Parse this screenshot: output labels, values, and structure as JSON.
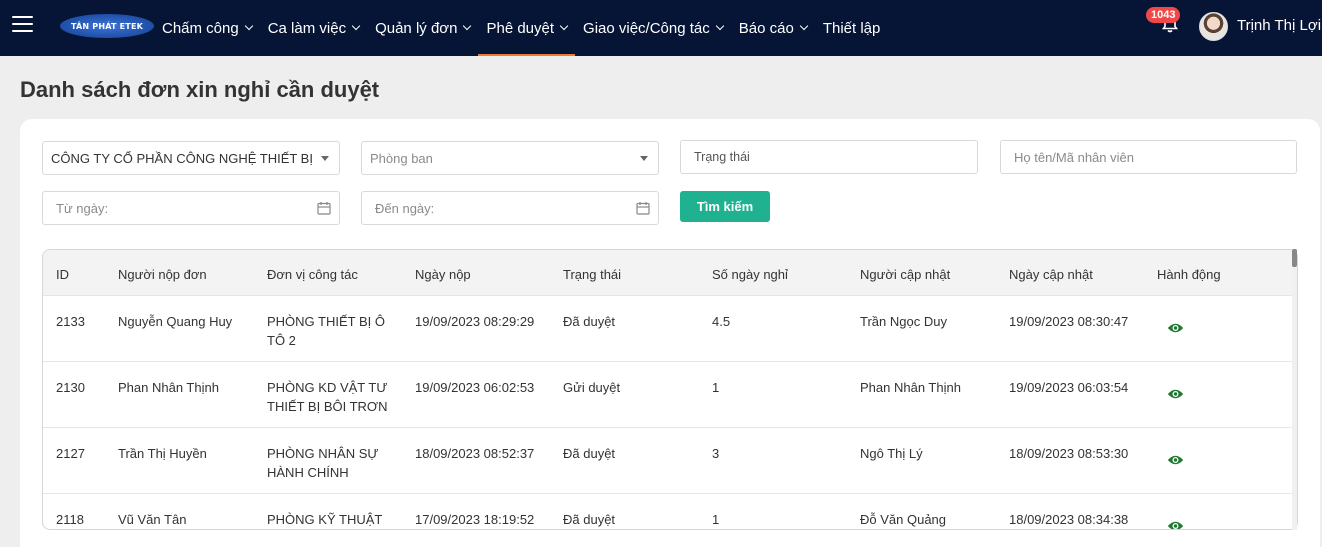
{
  "nav": {
    "logo_text": "TÂN PHÁT ETEK",
    "menu": [
      {
        "label": "Chấm công",
        "has_dropdown": true,
        "active": false
      },
      {
        "label": "Ca làm việc",
        "has_dropdown": true,
        "active": false
      },
      {
        "label": "Quản lý đơn",
        "has_dropdown": true,
        "active": false
      },
      {
        "label": "Phê duyệt",
        "has_dropdown": true,
        "active": true
      },
      {
        "label": "Giao việc/Công tác",
        "has_dropdown": true,
        "active": false
      },
      {
        "label": "Báo cáo",
        "has_dropdown": true,
        "active": false
      },
      {
        "label": "Thiết lập",
        "has_dropdown": false,
        "active": false
      }
    ],
    "notification_count": "1043",
    "user_name": "Trịnh Thị Lợi"
  },
  "page": {
    "title": "Danh sách đơn xin nghỉ cần duyệt"
  },
  "filters": {
    "company_value": "CÔNG TY CỔ PHẦN CÔNG NGHỆ THIẾT BỊ TÂ...",
    "department_placeholder": "Phòng ban",
    "status_placeholder": "Trạng thái",
    "employee_placeholder": "Họ tên/Mã nhân viên",
    "from_date_placeholder": "Từ ngày:",
    "to_date_placeholder": "Đến ngày:",
    "search_label": "Tìm kiếm"
  },
  "table": {
    "columns": [
      "ID",
      "Người nộp đơn",
      "Đơn vị công tác",
      "Ngày nộp",
      "Trạng thái",
      "Số ngày nghỉ",
      "Người cập nhật",
      "Ngày cập nhật",
      "Hành động"
    ],
    "rows": [
      {
        "id": "2133",
        "applicant": "Nguyễn Quang Huy",
        "unit": "PHÒNG THIẾT BỊ Ô TÔ 2",
        "submitted": "19/09/2023 08:29:29",
        "status": "Đã duyệt",
        "days": "4.5",
        "updated_by": "Trần Ngọc Duy",
        "updated_at": "19/09/2023 08:30:47"
      },
      {
        "id": "2130",
        "applicant": "Phan Nhân Thịnh",
        "unit": "PHÒNG KD VẬT TƯ THIẾT BỊ BÔI TRƠN",
        "submitted": "19/09/2023 06:02:53",
        "status": "Gửi duyệt",
        "days": "1",
        "updated_by": "Phan Nhân Thịnh",
        "updated_at": "19/09/2023 06:03:54"
      },
      {
        "id": "2127",
        "applicant": "Trần Thị Huyền",
        "unit": "PHÒNG NHÂN SỰ HÀNH CHÍNH",
        "submitted": "18/09/2023 08:52:37",
        "status": "Đã duyệt",
        "days": "3",
        "updated_by": "Ngô Thị Lý",
        "updated_at": "18/09/2023 08:53:30"
      },
      {
        "id": "2118",
        "applicant": "Vũ Văn Tân",
        "unit": "PHÒNG KỸ THUẬT",
        "submitted": "17/09/2023 18:19:52",
        "status": "Đã duyệt",
        "days": "1",
        "updated_by": "Đỗ Văn Quảng",
        "updated_at": "18/09/2023 08:34:38"
      }
    ]
  },
  "colors": {
    "nav_bg": "#061536",
    "accent": "#f07a34",
    "button": "#20b290",
    "eye_icon": "#1f7a2e",
    "badge": "#f04848"
  }
}
